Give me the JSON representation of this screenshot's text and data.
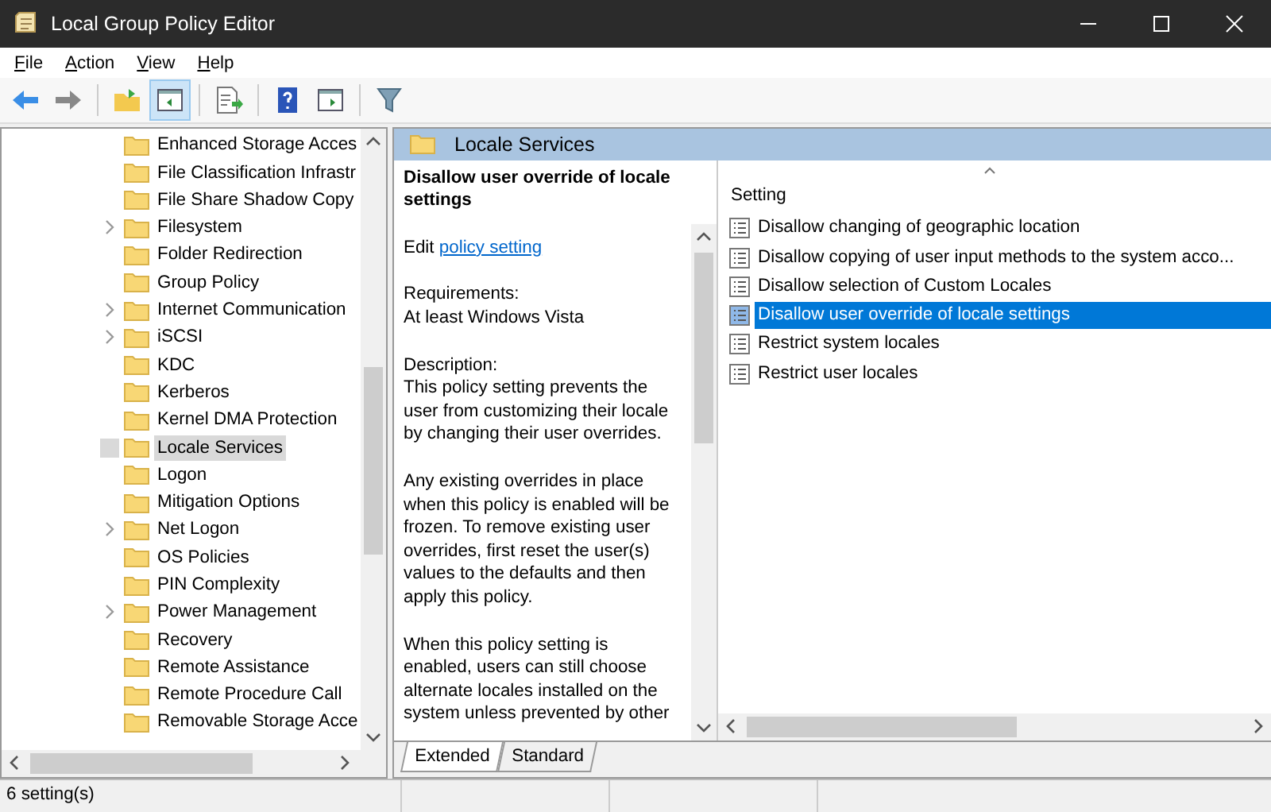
{
  "window": {
    "title": "Local Group Policy Editor"
  },
  "menu": [
    {
      "label": "File"
    },
    {
      "label": "Action"
    },
    {
      "label": "View"
    },
    {
      "label": "Help"
    }
  ],
  "tree": {
    "items": [
      {
        "label": "Enhanced Storage Acces",
        "expandable": false,
        "selected": false
      },
      {
        "label": "File Classification Infrastr",
        "expandable": false,
        "selected": false
      },
      {
        "label": "File Share Shadow Copy",
        "expandable": false,
        "selected": false
      },
      {
        "label": "Filesystem",
        "expandable": true,
        "selected": false
      },
      {
        "label": "Folder Redirection",
        "expandable": false,
        "selected": false
      },
      {
        "label": "Group Policy",
        "expandable": false,
        "selected": false
      },
      {
        "label": "Internet Communication",
        "expandable": true,
        "selected": false
      },
      {
        "label": "iSCSI",
        "expandable": true,
        "selected": false
      },
      {
        "label": "KDC",
        "expandable": false,
        "selected": false
      },
      {
        "label": "Kerberos",
        "expandable": false,
        "selected": false
      },
      {
        "label": "Kernel DMA Protection",
        "expandable": false,
        "selected": false
      },
      {
        "label": "Locale Services",
        "expandable": false,
        "selected": true
      },
      {
        "label": "Logon",
        "expandable": false,
        "selected": false
      },
      {
        "label": "Mitigation Options",
        "expandable": false,
        "selected": false
      },
      {
        "label": "Net Logon",
        "expandable": true,
        "selected": false
      },
      {
        "label": "OS Policies",
        "expandable": false,
        "selected": false
      },
      {
        "label": "PIN Complexity",
        "expandable": false,
        "selected": false
      },
      {
        "label": "Power Management",
        "expandable": true,
        "selected": false
      },
      {
        "label": "Recovery",
        "expandable": false,
        "selected": false
      },
      {
        "label": "Remote Assistance",
        "expandable": false,
        "selected": false
      },
      {
        "label": "Remote Procedure Call",
        "expandable": false,
        "selected": false
      },
      {
        "label": "Removable Storage Acce",
        "expandable": false,
        "selected": false
      }
    ]
  },
  "header": {
    "title": "Locale Services"
  },
  "details": {
    "title": "Disallow user override of locale settings",
    "edit": {
      "prefix": "Edit",
      "link": "policy setting"
    },
    "paragraphs": [
      {
        "lines": [
          "Requirements:",
          "At least Windows Vista"
        ]
      },
      {
        "lines": [
          "Description:",
          "This policy setting prevents the",
          "user from customizing their locale",
          "by changing their user overrides."
        ]
      },
      {
        "lines": [
          "Any existing overrides in place",
          "when this policy is enabled will be",
          "frozen. To remove existing user",
          "overrides, first reset the user(s)",
          "values to the defaults and then",
          "apply this policy."
        ]
      },
      {
        "lines": [
          "When this policy setting is",
          "enabled, users can still choose",
          "alternate locales installed on the",
          "system unless prevented by other"
        ]
      }
    ]
  },
  "settings": {
    "column": "Setting",
    "rows": [
      {
        "label": "Disallow changing of geographic location",
        "selected": false
      },
      {
        "label": "Disallow copying of user input methods to the system acco...",
        "selected": false
      },
      {
        "label": "Disallow selection of Custom Locales",
        "selected": false
      },
      {
        "label": "Disallow user override of locale settings",
        "selected": true
      },
      {
        "label": "Restrict system locales",
        "selected": false
      },
      {
        "label": "Restrict user locales",
        "selected": false
      }
    ]
  },
  "tabs": [
    {
      "label": "Extended",
      "selected": true
    },
    {
      "label": "Standard",
      "selected": false
    }
  ],
  "status_bar": {
    "text": "6 setting(s)"
  }
}
